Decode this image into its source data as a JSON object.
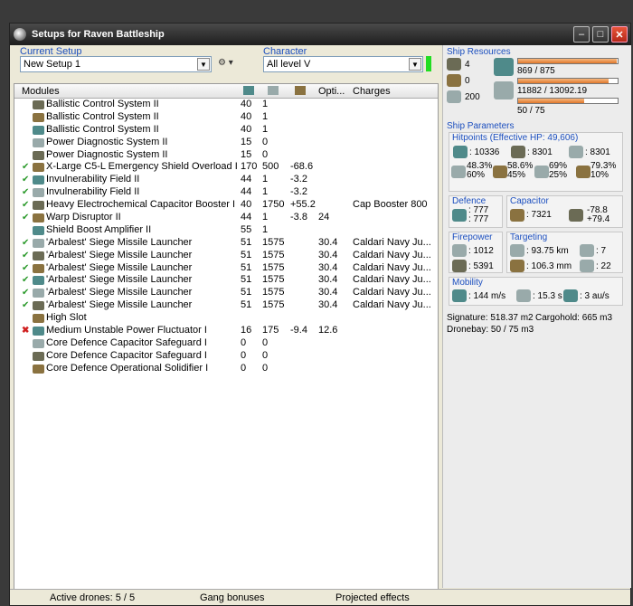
{
  "window": {
    "title": "Setups for Raven Battleship"
  },
  "setup": {
    "label": "Current Setup",
    "value": "New Setup 1"
  },
  "character": {
    "label": "Character",
    "value": "All level V",
    "status_color": "#22dd22"
  },
  "modules": {
    "headers": {
      "name": "Modules",
      "col4": "Opti...",
      "charges": "Charges"
    },
    "rows": [
      {
        "status": "",
        "name": "Ballistic Control System II",
        "c1": "40",
        "c2": "1",
        "c3": "",
        "c4": "",
        "charges": ""
      },
      {
        "status": "",
        "name": "Ballistic Control System II",
        "c1": "40",
        "c2": "1",
        "c3": "",
        "c4": "",
        "charges": ""
      },
      {
        "status": "",
        "name": "Ballistic Control System II",
        "c1": "40",
        "c2": "1",
        "c3": "",
        "c4": "",
        "charges": ""
      },
      {
        "status": "",
        "name": "Power Diagnostic System II",
        "c1": "15",
        "c2": "0",
        "c3": "",
        "c4": "",
        "charges": ""
      },
      {
        "status": "",
        "name": "Power Diagnostic System II",
        "c1": "15",
        "c2": "0",
        "c3": "",
        "c4": "",
        "charges": ""
      },
      {
        "status": "ok",
        "name": "X-Large C5-L Emergency Shield Overload I",
        "c1": "170",
        "c2": "500",
        "c3": "-68.6",
        "c4": "",
        "charges": ""
      },
      {
        "status": "ok",
        "name": "Invulnerability Field II",
        "c1": "44",
        "c2": "1",
        "c3": "-3.2",
        "c4": "",
        "charges": ""
      },
      {
        "status": "ok",
        "name": "Invulnerability Field II",
        "c1": "44",
        "c2": "1",
        "c3": "-3.2",
        "c4": "",
        "charges": ""
      },
      {
        "status": "ok",
        "name": "Heavy Electrochemical Capacitor Booster I",
        "c1": "40",
        "c2": "1750",
        "c3": "+55.2",
        "c4": "",
        "charges": "Cap Booster 800"
      },
      {
        "status": "ok",
        "name": "Warp Disruptor II",
        "c1": "44",
        "c2": "1",
        "c3": "-3.8",
        "c4": "24",
        "charges": ""
      },
      {
        "status": "",
        "name": "Shield Boost Amplifier II",
        "c1": "55",
        "c2": "1",
        "c3": "",
        "c4": "",
        "charges": ""
      },
      {
        "status": "ok",
        "name": "'Arbalest' Siege Missile Launcher",
        "c1": "51",
        "c2": "1575",
        "c3": "",
        "c4": "30.4",
        "charges": "Caldari Navy Ju..."
      },
      {
        "status": "ok",
        "name": "'Arbalest' Siege Missile Launcher",
        "c1": "51",
        "c2": "1575",
        "c3": "",
        "c4": "30.4",
        "charges": "Caldari Navy Ju..."
      },
      {
        "status": "ok",
        "name": "'Arbalest' Siege Missile Launcher",
        "c1": "51",
        "c2": "1575",
        "c3": "",
        "c4": "30.4",
        "charges": "Caldari Navy Ju..."
      },
      {
        "status": "ok",
        "name": "'Arbalest' Siege Missile Launcher",
        "c1": "51",
        "c2": "1575",
        "c3": "",
        "c4": "30.4",
        "charges": "Caldari Navy Ju..."
      },
      {
        "status": "ok",
        "name": "'Arbalest' Siege Missile Launcher",
        "c1": "51",
        "c2": "1575",
        "c3": "",
        "c4": "30.4",
        "charges": "Caldari Navy Ju..."
      },
      {
        "status": "ok",
        "name": "'Arbalest' Siege Missile Launcher",
        "c1": "51",
        "c2": "1575",
        "c3": "",
        "c4": "30.4",
        "charges": "Caldari Navy Ju..."
      },
      {
        "status": "",
        "name": "High Slot",
        "c1": "",
        "c2": "",
        "c3": "",
        "c4": "",
        "charges": ""
      },
      {
        "status": "bad",
        "name": "Medium Unstable Power Fluctuator I",
        "c1": "16",
        "c2": "175",
        "c3": "-9.4",
        "c4": "12.6",
        "charges": ""
      },
      {
        "status": "",
        "name": "Core Defence Capacitor Safeguard I",
        "c1": "0",
        "c2": "0",
        "c3": "",
        "c4": "",
        "charges": ""
      },
      {
        "status": "",
        "name": "Core Defence Capacitor Safeguard I",
        "c1": "0",
        "c2": "0",
        "c3": "",
        "c4": "",
        "charges": ""
      },
      {
        "status": "",
        "name": "Core Defence Operational Solidifier I",
        "c1": "0",
        "c2": "0",
        "c3": "",
        "c4": "",
        "charges": ""
      }
    ]
  },
  "resources": {
    "title": "Ship Resources",
    "hardpoints": {
      "turret": "4",
      "launcher": "0",
      "drone": "200"
    },
    "cpu": {
      "text": "869 / 875",
      "fraction": 0.993
    },
    "power": {
      "text": "11882 / 13092.19",
      "fraction": 0.908
    },
    "calibration": {
      "text": "50 / 75",
      "fraction": 0.667
    }
  },
  "params": {
    "title": "Ship Parameters",
    "hitpoints_title": "Hitpoints (Effective HP: 49,606)",
    "shield_hp": ": 10336",
    "armor_hp": ": 8301",
    "structure_hp": ": 8301",
    "resist1": "48.3%\n60%",
    "resist2": "58.6%\n45%",
    "resist3": "69%\n25%",
    "resist4": "79.3%\n10%",
    "defence_title": "Defence",
    "defence_val": ": 777\n: 777",
    "capacitor_title": "Capacitor",
    "cap_val": ": 7321",
    "cap_delta": "-78.8\n+79.4",
    "firepower_title": "Firepower",
    "fp1": ": 1012",
    "fp2": ": 5391",
    "targeting_title": "Targeting",
    "range": ": 93.75 km",
    "targets": ": 7",
    "scan": ": 106.3 mm",
    "sensor": ": 22",
    "mobility_title": "Mobility",
    "speed": ": 144 m/s",
    "align": ": 15.3 s",
    "warp": ": 3 au/s",
    "signature": "Signature: 518.37 m2",
    "cargohold": "Cargohold: 665 m3",
    "dronebay": "Dronebay: 50 / 75 m3"
  },
  "statusbar": {
    "drones": "Active drones: 5 / 5",
    "gang": "Gang bonuses",
    "projected": "Projected effects"
  }
}
